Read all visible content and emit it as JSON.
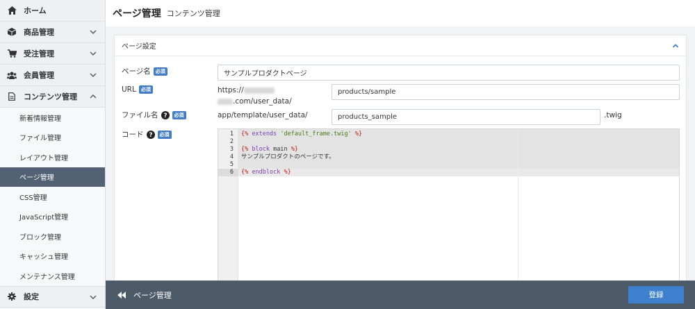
{
  "sidebar": {
    "items": [
      {
        "label": "ホーム",
        "icon": "home-icon"
      },
      {
        "label": "商品管理",
        "icon": "cube-icon"
      },
      {
        "label": "受注管理",
        "icon": "cart-icon"
      },
      {
        "label": "会員管理",
        "icon": "users-icon"
      },
      {
        "label": "コンテンツ管理",
        "icon": "document-icon"
      }
    ],
    "sub_items": [
      {
        "label": "新着情報管理"
      },
      {
        "label": "ファイル管理"
      },
      {
        "label": "レイアウト管理"
      },
      {
        "label": "ページ管理"
      },
      {
        "label": "CSS管理"
      },
      {
        "label": "JavaScript管理"
      },
      {
        "label": "ブロック管理"
      },
      {
        "label": "キャッシュ管理"
      },
      {
        "label": "メンテナンス管理"
      }
    ],
    "settings": {
      "label": "設定",
      "icon": "gear-icon"
    }
  },
  "header": {
    "title": "ページ管理",
    "subtitle": "コンテンツ管理"
  },
  "card": {
    "title": "ページ設定"
  },
  "form": {
    "required": "必須",
    "page_name": {
      "label": "ページ名",
      "value": "サンプルプロダクトページ"
    },
    "url": {
      "label": "URL",
      "prefix_line1": "https://",
      "prefix_line2": ".com/user_data/",
      "value": "products/sample"
    },
    "file_name": {
      "label": "ファイル名",
      "prefix": "app/template/user_data/",
      "value": "products_sample",
      "suffix": ".twig"
    },
    "code": {
      "label": "コード",
      "lines": [
        {
          "no": "1",
          "text": "{% extends 'default_frame.twig' %}"
        },
        {
          "no": "2",
          "text": ""
        },
        {
          "no": "3",
          "text": "{% block main %}"
        },
        {
          "no": "4",
          "text": "サンプルプロダクトのページです。"
        },
        {
          "no": "5",
          "text": ""
        },
        {
          "no": "6",
          "text": "{% endblock %}"
        }
      ]
    }
  },
  "footer": {
    "back_label": "ページ管理",
    "save_label": "登録"
  },
  "colors": {
    "accent": "#3e7fce",
    "sidebar_active": "#526173",
    "footer": "#4d5a68",
    "badge": "#437ec4"
  }
}
